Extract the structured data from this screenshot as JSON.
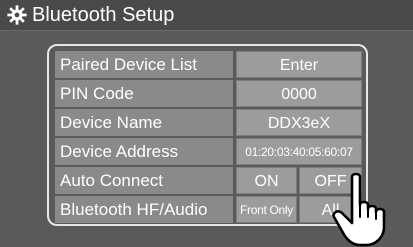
{
  "header": {
    "title": "Bluetooth Setup",
    "icon": "gear-icon"
  },
  "settings": {
    "paired_device_list": {
      "label": "Paired Device List",
      "value": "Enter"
    },
    "pin_code": {
      "label": "PIN Code",
      "value": "0000"
    },
    "device_name": {
      "label": "Device Name",
      "value": "DDX3eX"
    },
    "device_address": {
      "label": "Device Address",
      "value": "01:20:03:40:05:60:07"
    },
    "auto_connect": {
      "label": "Auto Connect",
      "option_on": "ON",
      "option_off": "OFF"
    },
    "bluetooth_hf_audio": {
      "label": "Bluetooth HF/Audio",
      "option_front": "Front Only",
      "option_all": "All"
    }
  },
  "overlay": {
    "icon": "pointing-hand-icon"
  },
  "colors": {
    "background": "#5a5a5a",
    "label_bg": "#8a8a8a",
    "button_bg": "#9c9c9c",
    "text": "#ffffff"
  }
}
